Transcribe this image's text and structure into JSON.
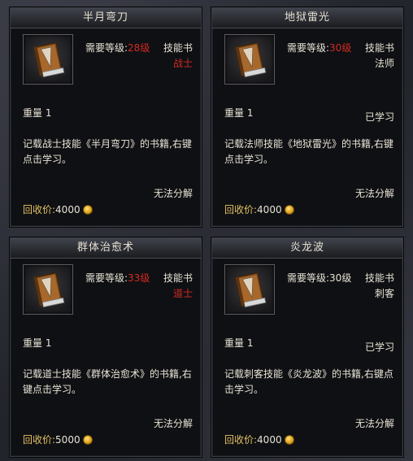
{
  "common": {
    "weight_label": "重量",
    "price_label": "回收价:",
    "require_label": "需要等级:",
    "no_split_label": "无法分解"
  },
  "cards": [
    {
      "title": "半月弯刀",
      "item_type": "技能书",
      "required_level": "28级",
      "level_requirement_met": false,
      "class_name": "战士",
      "class_color": "#d22a24",
      "weight": "1",
      "learned": "",
      "description": "记载战士技能《半月弯刀》的书籍,右键点击学习。",
      "price": "4000",
      "icon": "skill-book-icon"
    },
    {
      "title": "地狱雷光",
      "item_type": "技能书",
      "required_level": "30级",
      "level_requirement_met": false,
      "class_name": "法师",
      "class_color": "#e8e3d6",
      "weight": "1",
      "learned": "已学习",
      "description": "记载法师技能《地狱雷光》的书籍,右键点击学习。",
      "price": "4000",
      "icon": "skill-book-icon"
    },
    {
      "title": "群体治愈术",
      "item_type": "技能书",
      "required_level": "33级",
      "level_requirement_met": false,
      "class_name": "道士",
      "class_color": "#d22a24",
      "weight": "1",
      "learned": "",
      "description": "记载道士技能《群体治愈术》的书籍,右键点击学习。",
      "price": "5000",
      "icon": "skill-book-icon"
    },
    {
      "title": "炎龙波",
      "item_type": "技能书",
      "required_level": "30级",
      "level_requirement_met": true,
      "class_name": "刺客",
      "class_color": "#e8e3d6",
      "weight": "1",
      "learned": "已学习",
      "description": "记载刺客技能《炎龙波》的书籍,右键点击学习。",
      "price": "4000",
      "icon": "skill-book-icon"
    }
  ]
}
